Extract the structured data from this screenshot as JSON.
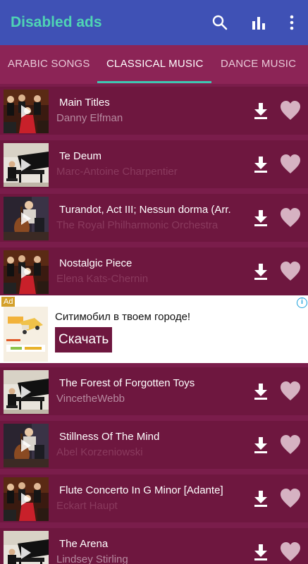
{
  "app": {
    "title": "Disabled ads"
  },
  "appbar": {
    "icons": [
      "search-icon",
      "equalizer-icon",
      "more-vert-icon"
    ]
  },
  "tabs": [
    {
      "label": "ARABIC SONGS",
      "active": false
    },
    {
      "label": "CLASSICAL MUSIC",
      "active": true
    },
    {
      "label": "DANCE MUSIC",
      "active": false
    }
  ],
  "songs": [
    {
      "title": "Main Titles",
      "artist": "Danny Elfman",
      "thumb": "orchestra"
    },
    {
      "title": "Te Deum",
      "artist": "Marc-Antoine Charpentier",
      "thumb": "piano"
    },
    {
      "title": "Turandot, Act III; Nessun dorma (Arr.",
      "artist": "The Royal Philharmonic Orchestra",
      "thumb": "cello"
    },
    {
      "title": "Nostalgic Piece",
      "artist": "Elena Kats-Chernin",
      "thumb": "orchestra"
    },
    {
      "title": "The Forest of Forgotten Toys",
      "artist": "VincetheWebb",
      "thumb": "piano"
    },
    {
      "title": "Stillness Of The Mind",
      "artist": "Abel Korzeniowski",
      "thumb": "cello"
    },
    {
      "title": "Flute Concerto In G Minor [Adante]",
      "artist": "Eckart Haupt",
      "thumb": "orchestra"
    },
    {
      "title": "The Arena",
      "artist": "Lindsey Stirling",
      "thumb": "piano"
    }
  ],
  "ad": {
    "badge": "Ad",
    "text": "Ситимобил в твоем городе!",
    "cta": "Скачать",
    "info_icon": "info-icon"
  },
  "colors": {
    "appbar": "#3f51b5",
    "title_accent": "#4fd4b4",
    "tab_bar": "#8c2456",
    "tab_indicator": "#3fc6b2",
    "row_bg": "#6e173f",
    "page_bg": "#7a1d4b",
    "heart": "#d6b2c2"
  }
}
